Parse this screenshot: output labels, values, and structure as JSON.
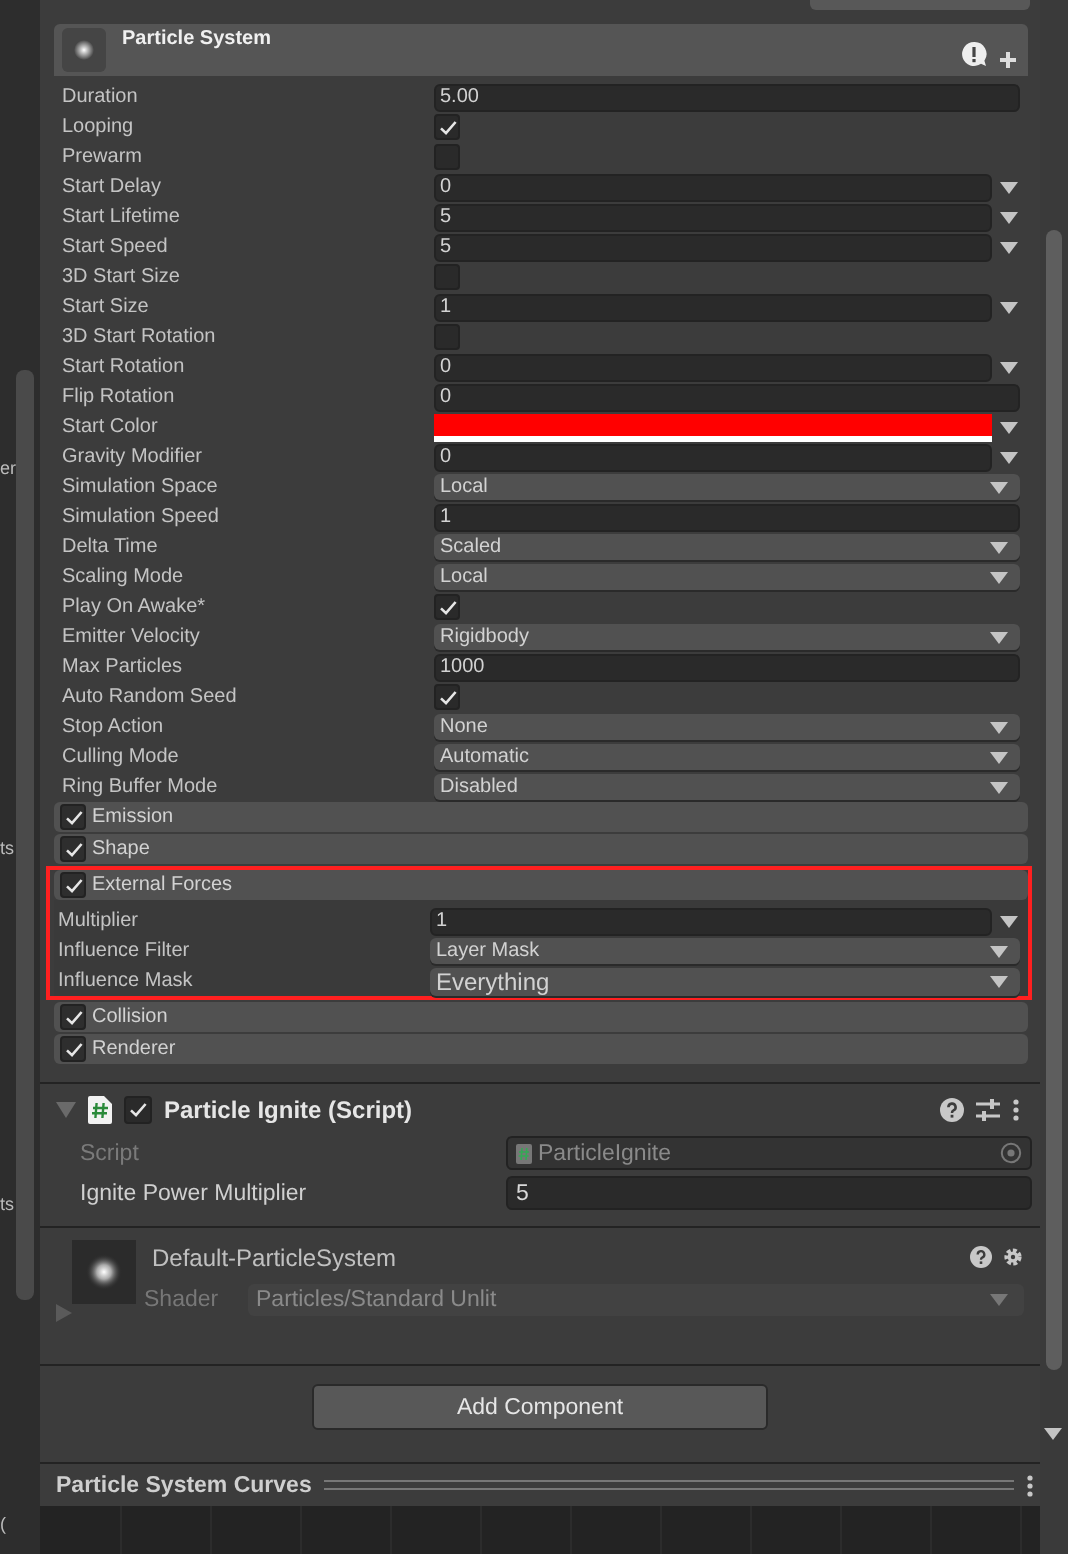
{
  "left_panel": {
    "fragments": [
      {
        "text": "er"
      },
      {
        "text": "ts"
      },
      {
        "text": "ts"
      },
      {
        "text": "("
      }
    ]
  },
  "particle_system": {
    "title": "Particle System",
    "properties": [
      {
        "label": "Duration",
        "kind": "field",
        "value": "5.00"
      },
      {
        "label": "Looping",
        "kind": "check",
        "checked": true
      },
      {
        "label": "Prewarm",
        "kind": "check",
        "checked": false
      },
      {
        "label": "Start Delay",
        "kind": "curve",
        "value": "0"
      },
      {
        "label": "Start Lifetime",
        "kind": "curve",
        "value": "5"
      },
      {
        "label": "Start Speed",
        "kind": "curve",
        "value": "5"
      },
      {
        "label": "3D Start Size",
        "kind": "check",
        "checked": false
      },
      {
        "label": "Start Size",
        "kind": "curve",
        "value": "1"
      },
      {
        "label": "3D Start Rotation",
        "kind": "check",
        "checked": false
      },
      {
        "label": "Start Rotation",
        "kind": "curve",
        "value": "0"
      },
      {
        "label": "Flip Rotation",
        "kind": "field",
        "value": "0"
      },
      {
        "label": "Start Color",
        "kind": "color",
        "color": "#ff0000"
      },
      {
        "label": "Gravity Modifier",
        "kind": "curve",
        "value": "0"
      },
      {
        "label": "Simulation Space",
        "kind": "dropdown",
        "value": "Local"
      },
      {
        "label": "Simulation Speed",
        "kind": "field",
        "value": "1"
      },
      {
        "label": "Delta Time",
        "kind": "dropdown",
        "value": "Scaled"
      },
      {
        "label": "Scaling Mode",
        "kind": "dropdown",
        "value": "Local"
      },
      {
        "label": "Play On Awake*",
        "kind": "check",
        "checked": true
      },
      {
        "label": "Emitter Velocity",
        "kind": "dropdown",
        "value": "Rigidbody"
      },
      {
        "label": "Max Particles",
        "kind": "field",
        "value": "1000"
      },
      {
        "label": "Auto Random Seed",
        "kind": "check",
        "checked": true
      },
      {
        "label": "Stop Action",
        "kind": "dropdown",
        "value": "None"
      },
      {
        "label": "Culling Mode",
        "kind": "dropdown",
        "value": "Automatic"
      },
      {
        "label": "Ring Buffer Mode",
        "kind": "dropdown",
        "value": "Disabled"
      }
    ],
    "modules": [
      {
        "name": "Emission",
        "checked": true,
        "highlighted": false
      },
      {
        "name": "Shape",
        "checked": true,
        "highlighted": false
      },
      {
        "name": "External Forces",
        "checked": true,
        "highlighted": true,
        "properties": [
          {
            "label": "Multiplier",
            "kind": "curve",
            "value": "1"
          },
          {
            "label": "Influence Filter",
            "kind": "dropdown",
            "value": "Layer Mask"
          },
          {
            "label": "Influence Mask",
            "kind": "mask",
            "value": "Everything"
          }
        ]
      },
      {
        "name": "Collision",
        "checked": true,
        "highlighted": false
      },
      {
        "name": "Renderer",
        "checked": true,
        "highlighted": false
      }
    ]
  },
  "script_component": {
    "title": "Particle Ignite (Script)",
    "enabled": true,
    "fields": [
      {
        "label": "Script",
        "kind": "object",
        "value": "ParticleIgnite",
        "disabled": true
      },
      {
        "label": "Ignite Power Multiplier",
        "kind": "field",
        "value": "5",
        "disabled": false
      }
    ]
  },
  "material": {
    "name": "Default-ParticleSystem",
    "shader_label": "Shader",
    "shader": "Particles/Standard Unlit"
  },
  "add_component_button": "Add Component",
  "curves_panel": {
    "title": "Particle System Curves"
  }
}
